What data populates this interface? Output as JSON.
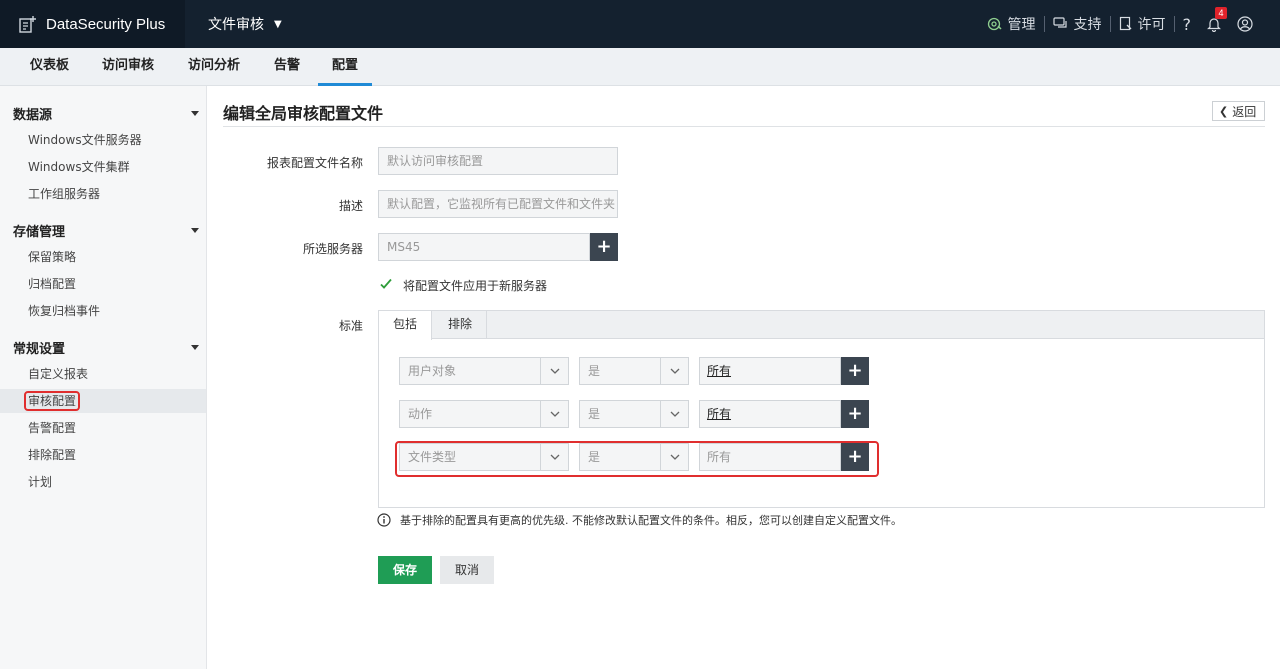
{
  "header": {
    "brand": "DataSecurity Plus",
    "module": "文件审核",
    "items": [
      {
        "label": "管理",
        "icon": "admin-gear-icon"
      },
      {
        "label": "支持",
        "icon": "chat-support-icon"
      },
      {
        "label": "许可",
        "icon": "license-icon"
      }
    ],
    "help_icon": "?",
    "notification_count": "4"
  },
  "nav": {
    "tabs": [
      "仪表板",
      "访问审核",
      "访问分析",
      "告警",
      "配置"
    ],
    "active": "配置"
  },
  "sidebar": {
    "sections": [
      {
        "title": "数据源",
        "items": [
          "Windows文件服务器",
          "Windows文件集群",
          "工作组服务器"
        ]
      },
      {
        "title": "存储管理",
        "items": [
          "保留策略",
          "归档配置",
          "恢复归档事件"
        ]
      },
      {
        "title": "常规设置",
        "items": [
          "自定义报表",
          "审核配置",
          "告警配置",
          "排除配置",
          "计划"
        ]
      }
    ],
    "active_item": "审核配置"
  },
  "main": {
    "title": "编辑全局审核配置文件",
    "back_label": "返回",
    "form": {
      "name_label": "报表配置文件名称",
      "name_value": "默认访问审核配置",
      "desc_label": "描述",
      "desc_value": "默认配置，它监视所有已配置文件和文件夹",
      "server_label": "所选服务器",
      "server_value": "MS45",
      "apply_checkbox_label": "将配置文件应用于新服务器",
      "apply_checked": true,
      "criteria_label": "标准"
    },
    "criteria": {
      "tabs": [
        "包括",
        "排除"
      ],
      "rows": [
        {
          "field": "用户对象",
          "operator": "是",
          "value": "所有"
        },
        {
          "field": "动作",
          "operator": "是",
          "value": "所有"
        },
        {
          "field": "文件类型",
          "operator": "是",
          "value": "所有"
        }
      ]
    },
    "info_text": "基于排除的配置具有更高的优先级. 不能修改默认配置文件的条件。相反，您可以创建自定义配置文件。",
    "save_label": "保存",
    "cancel_label": "取消"
  }
}
